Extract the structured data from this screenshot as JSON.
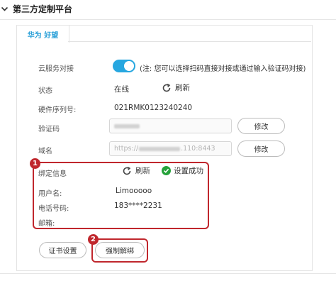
{
  "page": {
    "title": "第三方定制平台"
  },
  "tab": {
    "label": "华为 好望"
  },
  "cloud": {
    "label": "云服务对接",
    "toggle_on": true,
    "note": "(注: 您可以选择扫码直接对接或通过输入验证码对接)"
  },
  "status": {
    "label": "状态",
    "value": "在线",
    "refresh_label": "刷新"
  },
  "serial": {
    "label": "硬件序列号:",
    "value": "021RMK0123240240"
  },
  "verify": {
    "label": "验证码",
    "modify_label": "修改"
  },
  "domain": {
    "label": "域名",
    "value_prefix": "https://",
    "value_suffix": ".110:8443",
    "modify_label": "修改"
  },
  "bind": {
    "label": "绑定信息",
    "refresh_label": "刷新",
    "status_text": "设置成功",
    "user_label": "用户名:",
    "user_value": "Limooooo",
    "phone_label": "电话号码:",
    "phone_value": "183****2231",
    "email_label": "邮箱:"
  },
  "buttons": {
    "cert": "证书设置",
    "force_unbind": "强制解绑"
  },
  "markers": {
    "one": "1",
    "two": "2"
  },
  "colors": {
    "accent": "#27a7e0",
    "highlight": "#c0272d",
    "success": "#25a23a"
  }
}
